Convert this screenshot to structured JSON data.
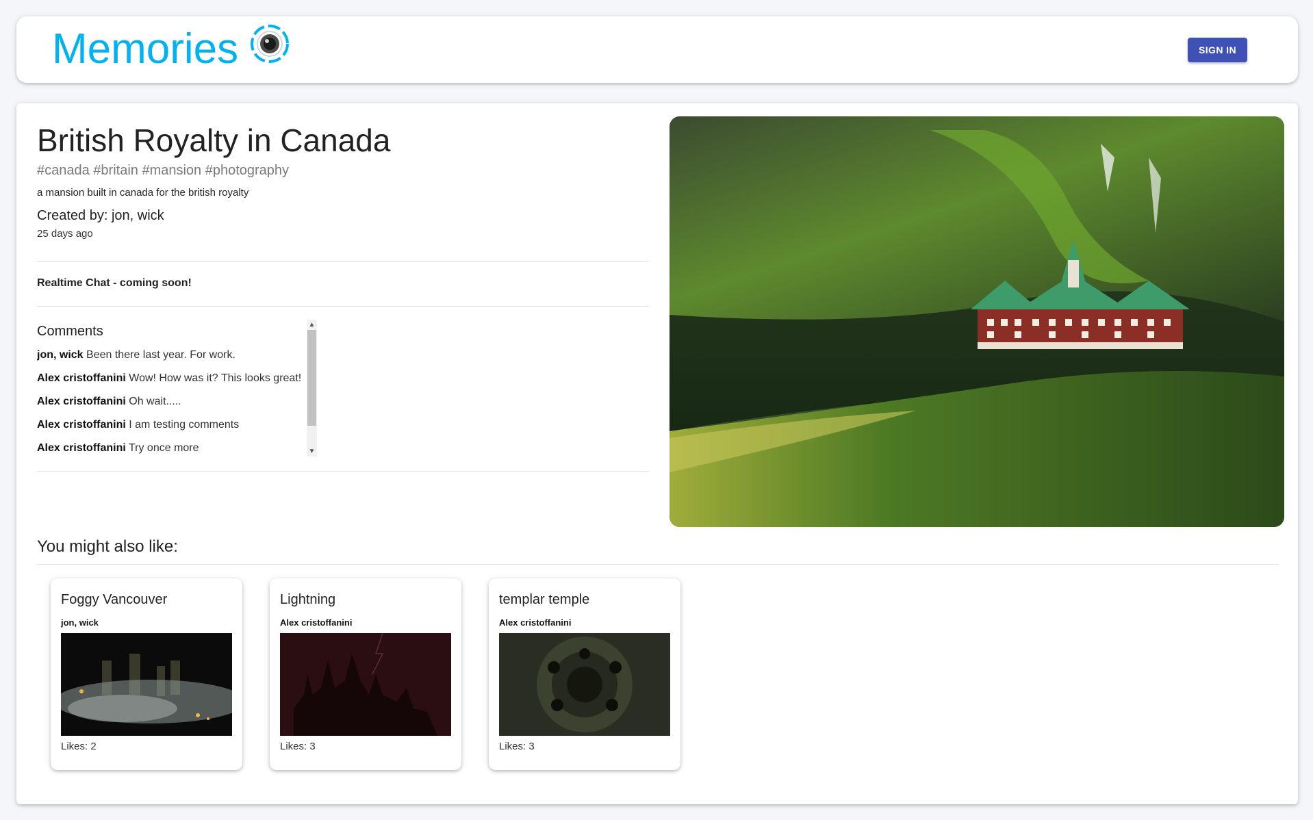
{
  "header": {
    "brand_title": "Memories",
    "logo_icon": "camera-lens-icon",
    "sign_in_label": "SIGN IN",
    "accent_color": "#00b3f0",
    "button_color": "#3f51b5"
  },
  "post": {
    "title": "British Royalty in Canada",
    "tags": "#canada #britain #mansion #photography",
    "message": "a mansion built in canada for the british royalty",
    "created_by": "Created by: jon, wick",
    "created_ago": "25 days ago",
    "realtime_chat": "Realtime Chat - coming soon!",
    "comments_title": "Comments",
    "comments": [
      {
        "author": "jon, wick",
        "text": "Been there last year. For work."
      },
      {
        "author": "Alex cristoffanini",
        "text": "Wow! How was it? This looks great!"
      },
      {
        "author": "Alex cristoffanini",
        "text": "Oh wait....."
      },
      {
        "author": "Alex cristoffanini",
        "text": "I am testing comments"
      },
      {
        "author": "Alex cristoffanini",
        "text": "Try once more"
      }
    ],
    "image_alt": "mansion-on-green-hill"
  },
  "recommendations": {
    "title": "You might also like:",
    "items": [
      {
        "title": "Foggy Vancouver",
        "author": "jon, wick",
        "likes": "Likes: 2",
        "image": "foggy-city-night"
      },
      {
        "title": "Lightning",
        "author": "Alex cristoffanini",
        "likes": "Likes: 3",
        "image": "dark-castle-lightning"
      },
      {
        "title": "templar temple",
        "author": "Alex cristoffanini",
        "likes": "Likes: 3",
        "image": "stone-well-spiral"
      }
    ]
  }
}
